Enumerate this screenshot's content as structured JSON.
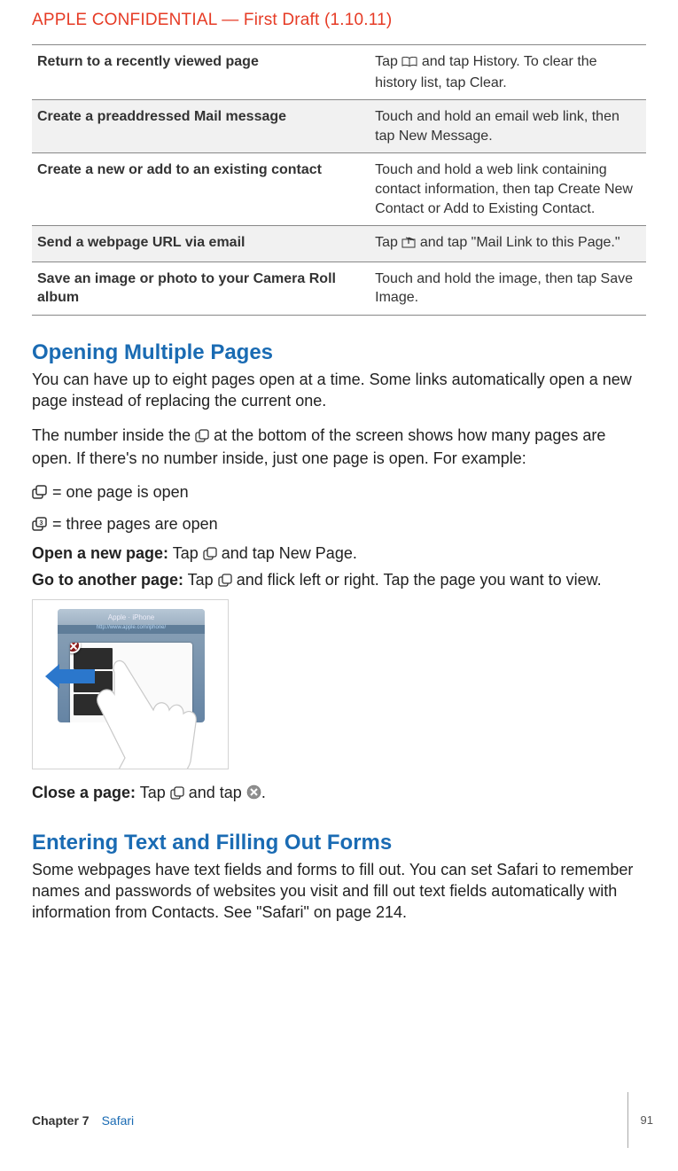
{
  "header": {
    "confidential": "APPLE CONFIDENTIAL — First Draft (1.10.11)"
  },
  "table": {
    "rows": [
      {
        "left": "Return to a recently viewed page",
        "right_pre": "Tap ",
        "right_post": " and tap History. To clear the history list, tap Clear.",
        "icon": "book"
      },
      {
        "left": "Create a preaddressed Mail message",
        "right": "Touch and hold an email web link, then tap New Message."
      },
      {
        "left": "Create a new or add to an existing contact",
        "right": "Touch and hold a web link containing contact information, then tap Create New Contact or Add to Existing Contact."
      },
      {
        "left": "Send a webpage URL via email",
        "right_pre": "Tap ",
        "right_post": " and tap \"Mail Link to this Page.\"",
        "icon": "share"
      },
      {
        "left": "Save an image or photo to your Camera Roll album",
        "right": "Touch and hold the image, then tap Save Image."
      }
    ]
  },
  "sections": {
    "opening": {
      "title": "Opening Multiple Pages",
      "p1": "You can have up to eight pages open at a time. Some links automatically open a new page instead of replacing the current one.",
      "p2_pre": "The number inside the ",
      "p2_post": " at the bottom of the screen shows how many pages are open. If there's no number inside, just one page is open. For example:",
      "one_page": " = one page is open",
      "three_pages": " = three pages are open",
      "open_page_label": "Open a new page:",
      "open_page_body_pre": "  Tap ",
      "open_page_body_post": " and tap New Page.",
      "goto_label": "Go to another page:",
      "goto_body_pre": "  Tap ",
      "goto_body_post": " and flick left or right. Tap the page you want to view.",
      "figure_title": "Apple · iPhone",
      "figure_url": "http://www.apple.com/iphone/",
      "close_label": "Close a page:",
      "close_body_pre": "  Tap ",
      "close_body_mid": " and tap ",
      "close_body_post": "."
    },
    "forms": {
      "title": "Entering Text and Filling Out Forms",
      "p1": "Some webpages have text fields and forms to fill out. You can set Safari to remember names and passwords of websites you visit and fill out text fields automatically with information from Contacts. See \"Safari\" on page 214."
    }
  },
  "footer": {
    "chapter": "Chapter 7",
    "section": "Safari",
    "page": "91"
  }
}
